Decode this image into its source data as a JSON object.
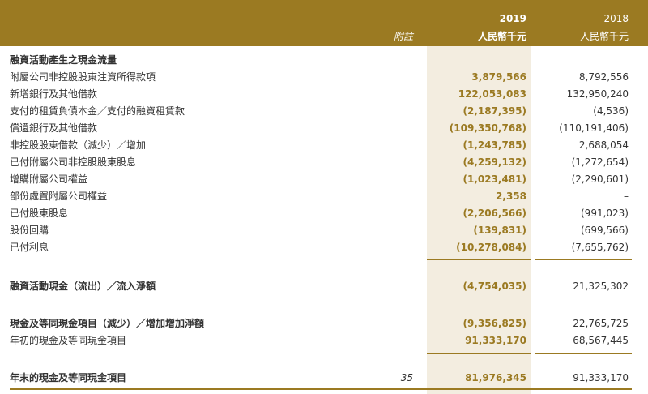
{
  "header": {
    "note_col": "附註",
    "year_2019": "2019",
    "unit_2019": "人民幣千元",
    "year_2018": "2018",
    "unit_2018": "人民幣千元"
  },
  "section_title": "融資活動產生之現金流量",
  "rows": [
    {
      "label": "附屬公司非控股股東注資所得款項",
      "v2019": "3,879,566",
      "v2018": "8,792,556"
    },
    {
      "label": "新增銀行及其他借款",
      "v2019": "122,053,083",
      "v2018": "132,950,240"
    },
    {
      "label": "支付的租賃負債本金／支付的融資租賃款",
      "v2019": "(2,187,395)",
      "v2018": "(4,536)"
    },
    {
      "label": "償還銀行及其他借款",
      "v2019": "(109,350,768)",
      "v2018": "(110,191,406)"
    },
    {
      "label": "非控股股東借款（減少）／增加",
      "v2019": "(1,243,785)",
      "v2018": "2,688,054"
    },
    {
      "label": "已付附屬公司非控股股東股息",
      "v2019": "(4,259,132)",
      "v2018": "(1,272,654)"
    },
    {
      "label": "增購附屬公司權益",
      "v2019": "(1,023,481)",
      "v2018": "(2,290,601)"
    },
    {
      "label": "部份處置附屬公司權益",
      "v2019": "2,358",
      "v2018": "–"
    },
    {
      "label": "已付股東股息",
      "v2019": "(2,206,566)",
      "v2018": "(991,023)"
    },
    {
      "label": "股份回購",
      "v2019": "(139,831)",
      "v2018": "(699,566)"
    },
    {
      "label": "已付利息",
      "v2019": "(10,278,084)",
      "v2018": "(7,655,762)"
    }
  ],
  "net_financing": {
    "label": "融資活動現金（流出）／流入淨額",
    "v2019": "(4,754,035)",
    "v2018": "21,325,302"
  },
  "net_change": {
    "label": "現金及等同現金項目（減少）／增加增加淨額",
    "v2019": "(9,356,825)",
    "v2018": "22,765,725"
  },
  "opening": {
    "label": "年初的現金及等同現金項目",
    "v2019": "91,333,170",
    "v2018": "68,567,445"
  },
  "closing": {
    "label": "年末的現金及等同現金項目",
    "note": "35",
    "v2019": "81,976,345",
    "v2018": "91,333,170"
  }
}
